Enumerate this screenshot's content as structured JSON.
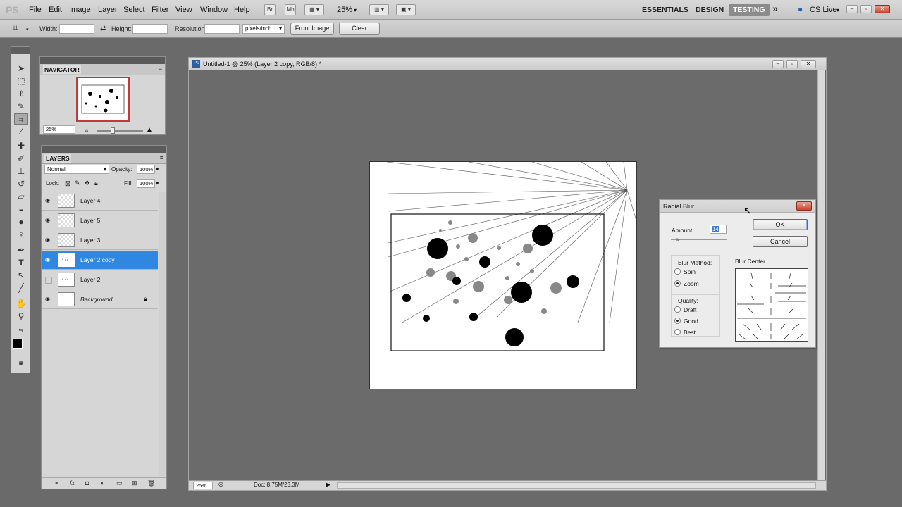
{
  "app": {
    "logo": "PS"
  },
  "menubar": {
    "items": [
      "File",
      "Edit",
      "Image",
      "Layer",
      "Select",
      "Filter",
      "View",
      "Window",
      "Help"
    ],
    "bridge_label": "Br",
    "minibridge_label": "Mb",
    "zoom": "25%",
    "workspaces": {
      "essentials": "ESSENTIALS",
      "design": "DESIGN",
      "testing": "TESTING"
    },
    "more": "»",
    "cslive": "CS Live"
  },
  "options": {
    "width_label": "Width:",
    "height_label": "Height:",
    "resolution_label": "Resolution:",
    "resolution_unit": "pixels/inch",
    "front_image": "Front Image",
    "clear": "Clear"
  },
  "navigator": {
    "tab": "NAVIGATOR",
    "zoom": "25%"
  },
  "layers": {
    "tab": "LAYERS",
    "blend_mode": "Normal",
    "opacity_label": "Opacity:",
    "opacity": "100%",
    "lock_label": "Lock:",
    "fill_label": "Fill:",
    "fill": "100%",
    "rows": [
      {
        "name": "Layer 4",
        "visible": true,
        "selected": false
      },
      {
        "name": "Layer 5",
        "visible": true,
        "selected": false
      },
      {
        "name": "Layer 3",
        "visible": true,
        "selected": false
      },
      {
        "name": "Layer 2 copy",
        "visible": true,
        "selected": true
      },
      {
        "name": "Layer 2",
        "visible": false,
        "selected": false
      },
      {
        "name": "Background",
        "visible": true,
        "selected": false
      }
    ]
  },
  "document": {
    "title": "Untitled-1 @ 25% (Layer 2 copy, RGB/8) *",
    "zoom": "25%",
    "doc_info": "Doc: 8.75M/23.3M"
  },
  "dialog": {
    "title": "Radial Blur",
    "amount_label": "Amount",
    "amount": "14",
    "ok": "OK",
    "cancel": "Cancel",
    "blur_method_label": "Blur Method:",
    "spin": "Spin",
    "zoom": "Zoom",
    "quality_label": "Quality:",
    "draft": "Draft",
    "good": "Good",
    "best": "Best",
    "blur_center_label": "Blur Center",
    "blur_method_selected": "Zoom",
    "quality_selected": "Good"
  },
  "colors": {
    "accent": "#2f87e1",
    "ui_bg": "#d6d6d6",
    "workspace_bg": "#6a6a6a"
  }
}
